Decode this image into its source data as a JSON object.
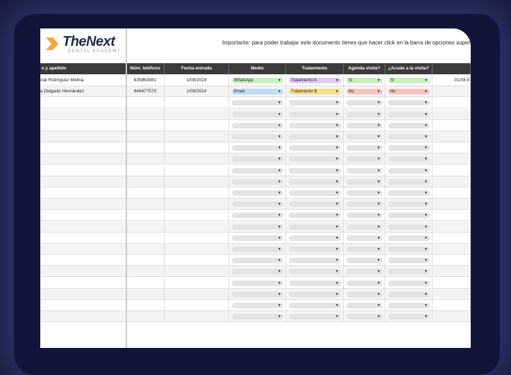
{
  "brand": {
    "name": "TheNext",
    "subtitle": "DENTAL ACADEMY",
    "accent": "#f4a63a"
  },
  "notice": "Importante: para poder trabajar este documento tienes que hacer click en la barra de opciones superior en  a",
  "columns": [
    {
      "key": "nombre",
      "label": "e y apellido"
    },
    {
      "key": "telefono",
      "label": "Núm. teléfono"
    },
    {
      "key": "fecha",
      "label": "Fecha entrada"
    },
    {
      "key": "medio",
      "label": "Medio"
    },
    {
      "key": "tratamiento",
      "label": "Tratamiento"
    },
    {
      "key": "agenda",
      "label": "Agenda visita?"
    },
    {
      "key": "acude",
      "label": "¿Acude a la visita?"
    },
    {
      "key": "extra",
      "label": ""
    }
  ],
  "rows": [
    {
      "nombre": "cial Rodríguez Molina",
      "telefono": "635863981",
      "fecha": "1/08/2024",
      "medio": "WhatsApp",
      "tratamiento": "Tratamiento A",
      "agenda": "Sí",
      "acude": "Sí",
      "extra": "01/08 E"
    },
    {
      "nombre": "a Delgado Hernández",
      "telefono": "649477570",
      "fecha": "1/08/2024",
      "medio": "Email",
      "tratamiento": "Tratamiento B",
      "agenda": "No",
      "acude": "No",
      "extra": ""
    }
  ],
  "empty_row_count": 20,
  "pill_colors": {
    "WhatsApp": "#c9efc0",
    "Email": "#bfdcf5",
    "Tratamiento A": "#dccbf3",
    "Tratamiento B": "#f8dd8f",
    "Sí": "#c9efc0",
    "No": "#f7c2bc",
    "empty": "#e3e3e3"
  },
  "dropdown_arrow": "▼"
}
